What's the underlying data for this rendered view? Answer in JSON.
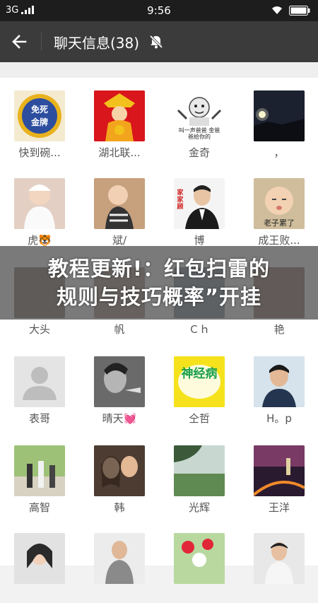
{
  "status_bar": {
    "network": "3G",
    "time": "9:56"
  },
  "header": {
    "title": "聊天信息(38)",
    "back_icon": "arrow-left-icon",
    "mute_icon": "bell-off-icon"
  },
  "members": [
    {
      "name": "快到碗..."
    },
    {
      "name": "湖北联..."
    },
    {
      "name": "金奇"
    },
    {
      "name": "，"
    },
    {
      "name": "虎🐯"
    },
    {
      "name": "斌/"
    },
    {
      "name": "博"
    },
    {
      "name": "成王败..."
    },
    {
      "name": "大头"
    },
    {
      "name": "帆"
    },
    {
      "name": "Ｃｈ"
    },
    {
      "name": "艳"
    },
    {
      "name": "表哥"
    },
    {
      "name": "晴天💓"
    },
    {
      "name": "仝哲"
    },
    {
      "name": "H。p"
    },
    {
      "name": "高智"
    },
    {
      "name": "韩"
    },
    {
      "name": "光辉"
    },
    {
      "name": "王洋"
    },
    {
      "name": ""
    },
    {
      "name": ""
    },
    {
      "name": ""
    },
    {
      "name": ""
    }
  ],
  "avatar_texts": {
    "a0_top": "免死",
    "a0_bottom": "金牌",
    "a2_caption": "叫一声爸爸 金爸爸给你的",
    "a6_side": "家家顾",
    "a7_caption": "老子累了",
    "a14_text": "神经病"
  },
  "banner": {
    "line1": "教程更新!：红包扫雷的",
    "line2": "规则与技巧概率”开挂"
  },
  "colors": {
    "status_bar": "#1d1d1d",
    "app_bar": "#3b3b3b",
    "banner_overlay": "#464646",
    "name_text": "#555555"
  }
}
